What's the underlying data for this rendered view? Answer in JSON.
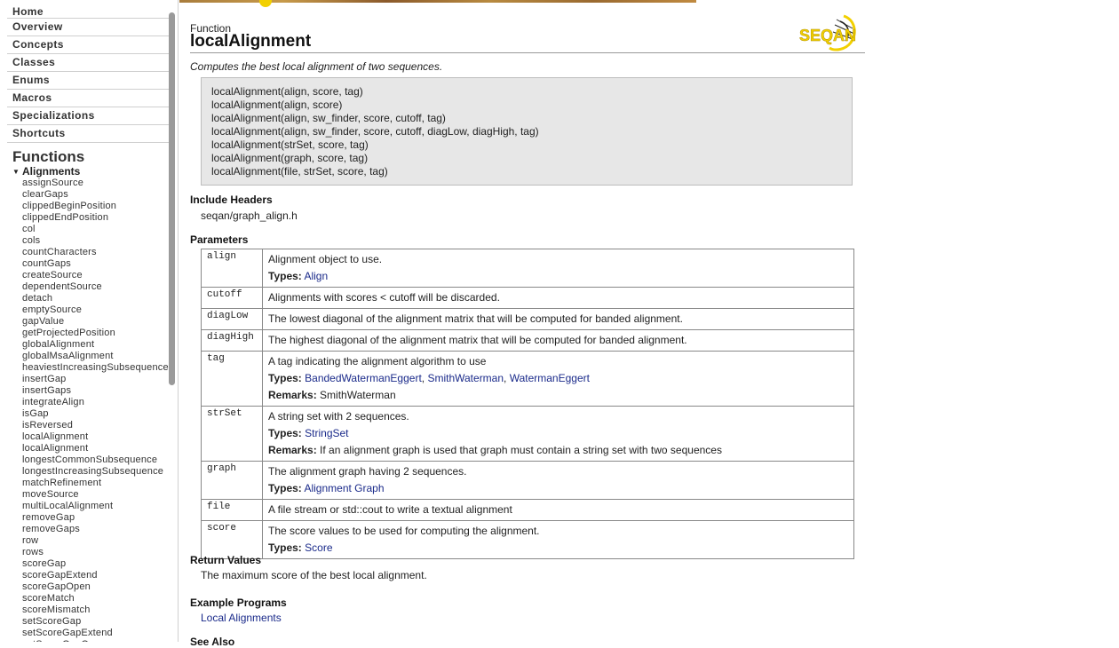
{
  "sidebar": {
    "nav": [
      "Home",
      "Overview",
      "Concepts",
      "Classes",
      "Enums",
      "Macros",
      "Specializations",
      "Shortcuts"
    ],
    "section_heading": "Functions",
    "group_label": "Alignments",
    "functions": [
      "assignSource",
      "clearGaps",
      "clippedBeginPosition",
      "clippedEndPosition",
      "col",
      "cols",
      "countCharacters",
      "countGaps",
      "createSource",
      "dependentSource",
      "detach",
      "emptySource",
      "gapValue",
      "getProjectedPosition",
      "globalAlignment",
      "globalMsaAlignment",
      "heaviestIncreasingSubsequence",
      "insertGap",
      "insertGaps",
      "integrateAlign",
      "isGap",
      "isReversed",
      "localAlignment",
      "localAlignment",
      "longestCommonSubsequence",
      "longestIncreasingSubsequence",
      "matchRefinement",
      "moveSource",
      "multiLocalAlignment",
      "removeGap",
      "removeGaps",
      "row",
      "rows",
      "scoreGap",
      "scoreGapExtend",
      "scoreGapOpen",
      "scoreMatch",
      "scoreMismatch",
      "setScoreGap",
      "setScoreGapExtend",
      "setScoreGapOpen"
    ]
  },
  "page": {
    "kind": "Function",
    "title": "localAlignment",
    "logo_text": "SEQAN",
    "description": "Computes the best local alignment of two sequences.",
    "signatures": [
      "localAlignment(align, score, tag)",
      "localAlignment(align, score)",
      "localAlignment(align, sw_finder, score, cutoff, tag)",
      "localAlignment(align, sw_finder, score, cutoff, diagLow, diagHigh, tag)",
      "localAlignment(strSet, score, tag)",
      "localAlignment(graph, score, tag)",
      "localAlignment(file, strSet, score, tag)"
    ],
    "include_heading": "Include Headers",
    "include_file": "seqan/graph_align.h",
    "params_heading": "Parameters",
    "types_label": "Types:",
    "remarks_label": "Remarks:",
    "params": {
      "align": {
        "name": "align",
        "desc": "Alignment object to use.",
        "types": "Align"
      },
      "cutoff": {
        "name": "cutoff",
        "desc": "Alignments with scores < cutoff will be discarded."
      },
      "diagLow": {
        "name": "diagLow",
        "desc": "The lowest diagonal of the alignment matrix that will be computed for banded alignment."
      },
      "diagHigh": {
        "name": "diagHigh",
        "desc": "The highest diagonal of the alignment matrix that will be computed for banded alignment."
      },
      "tag": {
        "name": "tag",
        "desc": "A tag indicating the alignment algorithm to use",
        "types": [
          "BandedWatermanEggert",
          "SmithWaterman",
          "WatermanEggert"
        ],
        "remarks": "SmithWaterman"
      },
      "strSet": {
        "name": "strSet",
        "desc": "A string set with 2 sequences.",
        "types": "StringSet",
        "remarks": "If an alignment graph is used that graph must contain a string set with two sequences"
      },
      "graph": {
        "name": "graph",
        "desc": "The alignment graph having 2 sequences.",
        "types": "Alignment Graph"
      },
      "file": {
        "name": "file",
        "desc": "A file stream or std::cout to write a textual alignment"
      },
      "score": {
        "name": "score",
        "desc": "The score values to be used for computing the alignment.",
        "types": "Score"
      }
    },
    "return_heading": "Return Values",
    "return_text": "The maximum score of the best local alignment.",
    "examples_heading": "Example Programs",
    "example_link": "Local Alignments",
    "see_also_heading": "See Also"
  },
  "colors": {
    "link": "#1a2a8a",
    "signature_bg": "#e7e7e7",
    "logo_yellow": "#f2d000"
  }
}
